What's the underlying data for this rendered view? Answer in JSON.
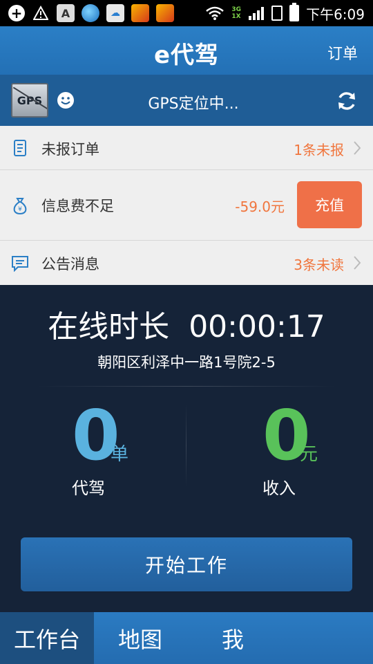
{
  "status_bar": {
    "a_icon_text": "A",
    "network_top": "3G",
    "network_bottom": "1X",
    "time": "下午6:09"
  },
  "header": {
    "logo": "e代驾",
    "orders_link": "订单"
  },
  "gps_bar": {
    "badge_text": "GPS",
    "status_text": "GPS定位中..."
  },
  "info_rows": [
    {
      "label": "未报订单",
      "value": "1条未报",
      "icon": "document-icon"
    },
    {
      "label": "信息费不足",
      "value": "-59.0元",
      "icon": "money-bag-icon",
      "action": "充值"
    },
    {
      "label": "公告消息",
      "value": "3条未读",
      "icon": "message-icon"
    }
  ],
  "main": {
    "online_label": "在线时长",
    "online_time": "00:00:17",
    "address": "朝阳区利泽中一路1号院2-5",
    "stats": [
      {
        "value": "0",
        "unit": "单",
        "label": "代驾",
        "color": "#5ab2df"
      },
      {
        "value": "0",
        "unit": "元",
        "label": "收入",
        "color": "#59c25a"
      }
    ],
    "start_button": "开始工作"
  },
  "tabs": [
    {
      "label": "工作台",
      "active": true
    },
    {
      "label": "地图",
      "active": false
    },
    {
      "label": "我",
      "active": false
    }
  ],
  "colors": {
    "header_blue": "#2b7fc6",
    "accent_orange": "#ef7048",
    "dark_bg": "#152338",
    "stat_blue": "#5ab2df",
    "stat_green": "#59c25a"
  }
}
